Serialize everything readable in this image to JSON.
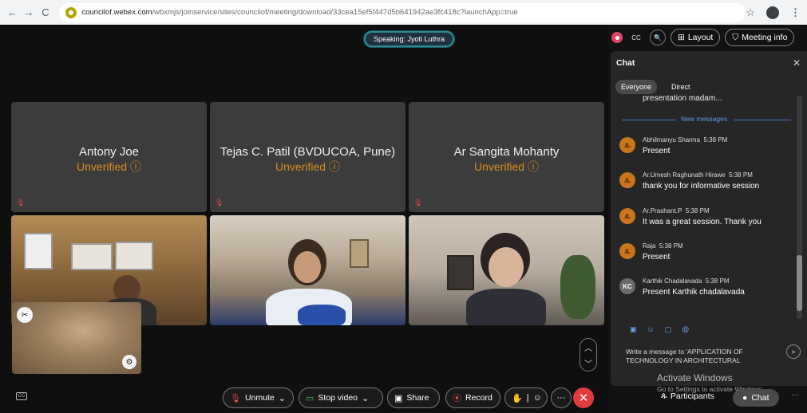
{
  "browser": {
    "url_domain": "councilof.webex.com",
    "url_path": "/wbxmjs/joinservice/sites/councilof/meeting/download/33cea15ef5f447d5b641942ae3fc418c?launchApp=true"
  },
  "meeting": {
    "speaking": "Speaking: Jyoti Luthra",
    "tiles": [
      {
        "name": "Antony Joe",
        "status": "Unverified ⓘ"
      },
      {
        "name": "Tejas C. Patil (BVDUCOA, Pune)",
        "status": "Unverified ⓘ"
      },
      {
        "name": "Ar Sangita Mohanty",
        "status": "Unverified ⓘ"
      }
    ]
  },
  "controls": {
    "unmute": "Unmute",
    "stop_video": "Stop video",
    "share": "Share",
    "record": "Record"
  },
  "panel_top": {
    "layout": "Layout",
    "meeting_info": "Meeting info"
  },
  "chat": {
    "title": "Chat",
    "tabs": [
      "Everyone",
      "Direct"
    ],
    "previous_tail": "presentation madam...",
    "new_messages": "New messages",
    "messages": [
      {
        "sender": "Abhilmanyu Sharma",
        "time": "5:38 PM",
        "text": "Present"
      },
      {
        "sender": "Ar.Umesh Raghunath Hirawe",
        "time": "5:38 PM",
        "text": "thank you for informative session"
      },
      {
        "sender": "Ar.Prashant.P",
        "time": "5:38 PM",
        "text": "It was a great session. Thank you"
      },
      {
        "sender": "Raja",
        "time": "5:38 PM",
        "text": "Present"
      },
      {
        "sender": "Karthik Chadalavada",
        "time": "5:38 PM",
        "text": "Present Karthik chadalavada",
        "initials": "KC"
      }
    ],
    "compose_placeholder": "Write a message to 'APPLICATION OF TECHNOLOGY IN ARCHITECTURAL"
  },
  "watermark": {
    "line1": "Activate Windows",
    "line2": "Go to Settings to activate Windows."
  },
  "footer": {
    "participants": "Participants",
    "chat": "Chat"
  }
}
